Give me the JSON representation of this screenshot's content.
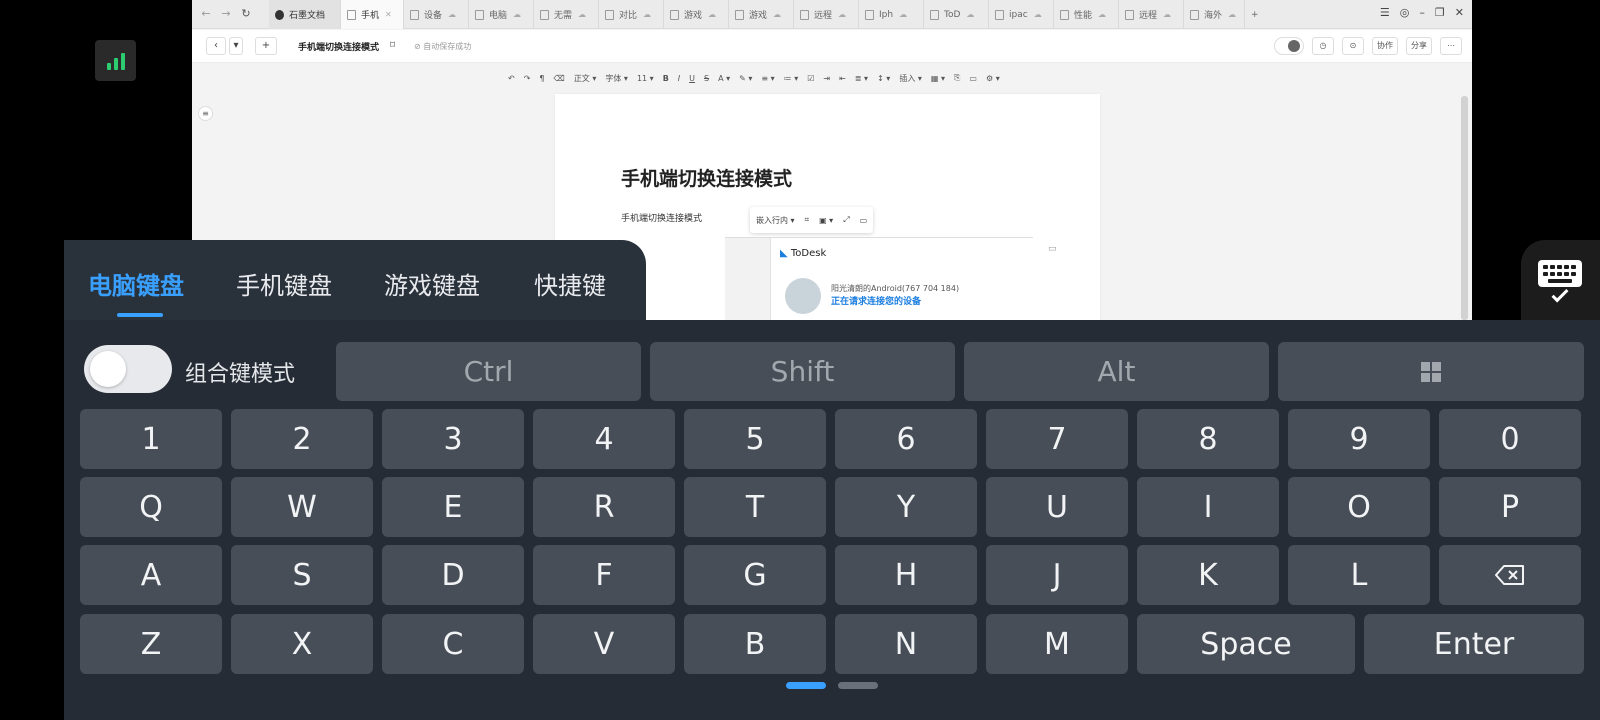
{
  "remote": {
    "tabs": [
      "石墨文档",
      "手机",
      "设备",
      "电脑",
      "无需",
      "对比",
      "游戏",
      "游戏",
      "远程",
      "Iph",
      "ToD",
      "ipac",
      "性能",
      "远程",
      "海外"
    ],
    "doc_title": "手机端切换连接模式",
    "save_status": "自动保存成功",
    "collab_label": "协作",
    "share_label": "分享",
    "format_toolbar": {
      "style": "正文",
      "font": "字体",
      "size": "11",
      "insert": "插入"
    },
    "doc_heading": "手机端切换连接模式",
    "doc_paragraph": "手机端切换连接模式",
    "image_toolbar_layout": "嵌入行内",
    "todesk": {
      "brand": "ToDesk",
      "device_name": "阳光清朗的Android(767 704 184)",
      "status": "正在请求连接您的设备"
    },
    "icons": [
      "back-icon",
      "forward-icon",
      "refresh-icon",
      "bookmark-icon",
      "history-icon",
      "more-icon",
      "comment-icon"
    ]
  },
  "keyboard": {
    "tabs": [
      "电脑键盘",
      "手机键盘",
      "游戏键盘",
      "快捷键"
    ],
    "active_tab": "电脑键盘",
    "combo_mode_label": "组合键模式",
    "combo_mode_on": false,
    "modifiers": [
      "Ctrl",
      "Shift",
      "Alt"
    ],
    "rows": [
      [
        "1",
        "2",
        "3",
        "4",
        "5",
        "6",
        "7",
        "8",
        "9",
        "0"
      ],
      [
        "Q",
        "W",
        "E",
        "R",
        "T",
        "Y",
        "U",
        "I",
        "O",
        "P"
      ],
      [
        "A",
        "S",
        "D",
        "F",
        "G",
        "H",
        "J",
        "K",
        "L"
      ],
      [
        "Z",
        "X",
        "C",
        "V",
        "B",
        "N",
        "M"
      ]
    ],
    "space_label": "Space",
    "enter_label": "Enter",
    "page": 1,
    "page_count": 2
  },
  "colors": {
    "accent": "#3aa0ff",
    "keyboard_bg": "#252c35",
    "key_bg": "#474e57",
    "signal": "#2ecc71"
  }
}
